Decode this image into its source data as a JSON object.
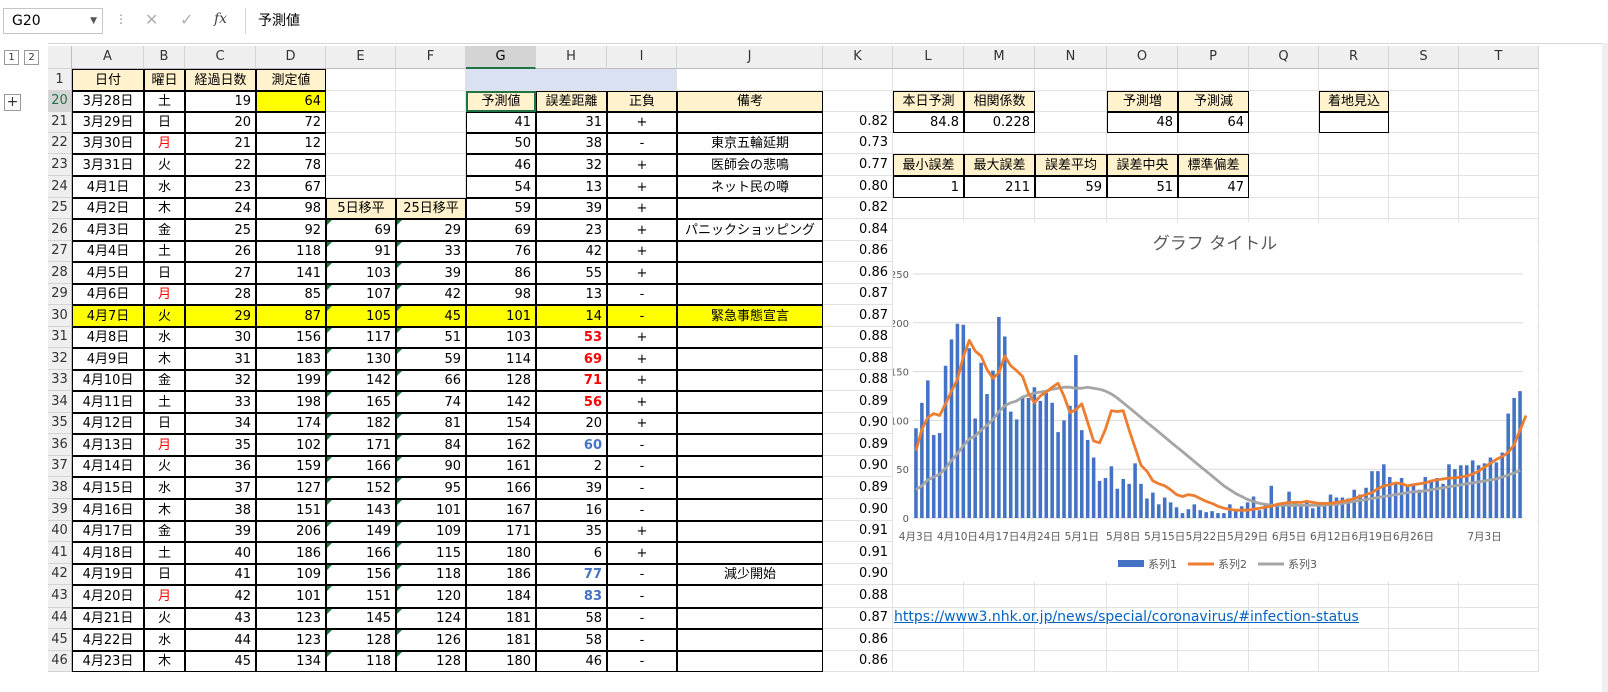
{
  "formula_bar": {
    "name_box": "G20",
    "formula": "予測値",
    "fx": "fx"
  },
  "outline": {
    "levels": [
      "1",
      "2"
    ],
    "expand": "+"
  },
  "columns": [
    "A",
    "B",
    "C",
    "D",
    "E",
    "F",
    "G",
    "H",
    "I",
    "J",
    "K",
    "L",
    "M",
    "N",
    "O",
    "P",
    "Q",
    "R",
    "S",
    "T"
  ],
  "row1": {
    "num": "1",
    "A": "日付",
    "B": "曜日",
    "C": "経過日数",
    "D": "測定値"
  },
  "header_row": {
    "num": "20",
    "A": "3月28日",
    "B": "土",
    "C": "19",
    "D": "64",
    "G": "予測値",
    "H": "誤差距離",
    "I": "正負",
    "J": "備考",
    "L": "本日予測",
    "M": "相関係数",
    "O": "予測増",
    "P": "予測減",
    "R": "着地見込"
  },
  "rows": [
    {
      "num": "21",
      "A": "3月29日",
      "B": "日",
      "C": "20",
      "D": "72",
      "E": "",
      "F": "",
      "G": "41",
      "H": "31",
      "I": "+",
      "J": "",
      "K": "0.82",
      "L": "84.8",
      "M": "0.228",
      "O": "48",
      "P": "64"
    },
    {
      "num": "22",
      "A": "3月30日",
      "B": "月",
      "C": "21",
      "D": "12",
      "E": "",
      "F": "",
      "G": "50",
      "H": "38",
      "I": "-",
      "J": "東京五輪延期",
      "K": "0.73"
    },
    {
      "num": "23",
      "A": "3月31日",
      "B": "火",
      "C": "22",
      "D": "78",
      "E": "",
      "F": "",
      "G": "46",
      "H": "32",
      "I": "+",
      "J": "医師会の悲鳴",
      "K": "0.77",
      "L": "最小誤差",
      "M": "最大誤差",
      "N": "誤差平均",
      "O": "誤差中央",
      "P": "標準偏差"
    },
    {
      "num": "24",
      "A": "4月1日",
      "B": "水",
      "C": "23",
      "D": "67",
      "E": "",
      "F": "",
      "G": "54",
      "H": "13",
      "I": "+",
      "J": "ネット民の噂",
      "K": "0.80",
      "L": "1",
      "M": "211",
      "N": "59",
      "O": "51",
      "P": "47"
    },
    {
      "num": "25",
      "A": "4月2日",
      "B": "木",
      "C": "24",
      "D": "98",
      "E": "5日移平",
      "F": "25日移平",
      "G": "59",
      "H": "39",
      "I": "+",
      "J": "",
      "K": "0.82"
    },
    {
      "num": "26",
      "A": "4月3日",
      "B": "金",
      "C": "25",
      "D": "92",
      "E": "69",
      "F": "29",
      "G": "69",
      "H": "23",
      "I": "+",
      "J": "パニックショッピング",
      "K": "0.84"
    },
    {
      "num": "27",
      "A": "4月4日",
      "B": "土",
      "C": "26",
      "D": "118",
      "E": "91",
      "F": "33",
      "G": "76",
      "H": "42",
      "I": "+",
      "J": "",
      "K": "0.86"
    },
    {
      "num": "28",
      "A": "4月5日",
      "B": "日",
      "C": "27",
      "D": "141",
      "E": "103",
      "F": "39",
      "G": "86",
      "H": "55",
      "I": "+",
      "J": "",
      "K": "0.86"
    },
    {
      "num": "29",
      "A": "4月6日",
      "B": "月",
      "C": "28",
      "D": "85",
      "E": "107",
      "F": "42",
      "G": "98",
      "H": "13",
      "I": "-",
      "J": "",
      "K": "0.87"
    },
    {
      "num": "30",
      "A": "4月7日",
      "B": "火",
      "C": "29",
      "D": "87",
      "E": "105",
      "F": "45",
      "G": "101",
      "H": "14",
      "I": "-",
      "J": "緊急事態宣言",
      "K": "0.87"
    },
    {
      "num": "31",
      "A": "4月8日",
      "B": "水",
      "C": "30",
      "D": "156",
      "E": "117",
      "F": "51",
      "G": "103",
      "H": "53",
      "I": "+",
      "J": "",
      "K": "0.88"
    },
    {
      "num": "32",
      "A": "4月9日",
      "B": "木",
      "C": "31",
      "D": "183",
      "E": "130",
      "F": "59",
      "G": "114",
      "H": "69",
      "I": "+",
      "J": "",
      "K": "0.88"
    },
    {
      "num": "33",
      "A": "4月10日",
      "B": "金",
      "C": "32",
      "D": "199",
      "E": "142",
      "F": "66",
      "G": "128",
      "H": "71",
      "I": "+",
      "J": "",
      "K": "0.88"
    },
    {
      "num": "34",
      "A": "4月11日",
      "B": "土",
      "C": "33",
      "D": "198",
      "E": "165",
      "F": "74",
      "G": "142",
      "H": "56",
      "I": "+",
      "J": "",
      "K": "0.89"
    },
    {
      "num": "35",
      "A": "4月12日",
      "B": "日",
      "C": "34",
      "D": "174",
      "E": "182",
      "F": "81",
      "G": "154",
      "H": "20",
      "I": "+",
      "J": "",
      "K": "0.90"
    },
    {
      "num": "36",
      "A": "4月13日",
      "B": "月",
      "C": "35",
      "D": "102",
      "E": "171",
      "F": "84",
      "G": "162",
      "H": "60",
      "I": "-",
      "J": "",
      "K": "0.89"
    },
    {
      "num": "37",
      "A": "4月14日",
      "B": "火",
      "C": "36",
      "D": "159",
      "E": "166",
      "F": "90",
      "G": "161",
      "H": "2",
      "I": "-",
      "J": "",
      "K": "0.90"
    },
    {
      "num": "38",
      "A": "4月15日",
      "B": "水",
      "C": "37",
      "D": "127",
      "E": "152",
      "F": "95",
      "G": "166",
      "H": "39",
      "I": "-",
      "J": "",
      "K": "0.89"
    },
    {
      "num": "39",
      "A": "4月16日",
      "B": "木",
      "C": "38",
      "D": "151",
      "E": "143",
      "F": "101",
      "G": "167",
      "H": "16",
      "I": "-",
      "J": "",
      "K": "0.90"
    },
    {
      "num": "40",
      "A": "4月17日",
      "B": "金",
      "C": "39",
      "D": "206",
      "E": "149",
      "F": "109",
      "G": "171",
      "H": "35",
      "I": "+",
      "J": "",
      "K": "0.91"
    },
    {
      "num": "41",
      "A": "4月18日",
      "B": "土",
      "C": "40",
      "D": "186",
      "E": "166",
      "F": "115",
      "G": "180",
      "H": "6",
      "I": "+",
      "J": "",
      "K": "0.91"
    },
    {
      "num": "42",
      "A": "4月19日",
      "B": "日",
      "C": "41",
      "D": "109",
      "E": "156",
      "F": "118",
      "G": "186",
      "H": "77",
      "I": "-",
      "J": "減少開始",
      "K": "0.90"
    },
    {
      "num": "43",
      "A": "4月20日",
      "B": "月",
      "C": "42",
      "D": "101",
      "E": "151",
      "F": "120",
      "G": "184",
      "H": "83",
      "I": "-",
      "J": "",
      "K": "0.88"
    },
    {
      "num": "44",
      "A": "4月21日",
      "B": "火",
      "C": "43",
      "D": "123",
      "E": "145",
      "F": "124",
      "G": "181",
      "H": "58",
      "I": "-",
      "J": "",
      "K": "0.87"
    },
    {
      "num": "45",
      "A": "4月22日",
      "B": "水",
      "C": "44",
      "D": "123",
      "E": "128",
      "F": "126",
      "G": "181",
      "H": "58",
      "I": "-",
      "J": "",
      "K": "0.86"
    },
    {
      "num": "46",
      "A": "4月23日",
      "B": "木",
      "C": "45",
      "D": "134",
      "E": "118",
      "F": "128",
      "G": "180",
      "H": "46",
      "I": "-",
      "J": "",
      "K": "0.86"
    }
  ],
  "link": "https://www3.nhk.or.jp/news/special/coronavirus/#infection-status",
  "chart_data": {
    "type": "bar",
    "title": "グラフ タイトル",
    "ylim": [
      0,
      250
    ],
    "yticks": [
      "0",
      "50",
      "100",
      "150",
      "200",
      "250"
    ],
    "xticks": [
      "4月3日",
      "4月10日",
      "4月17日",
      "4月24日",
      "5月1日",
      "5月8日",
      "5月15日",
      "5月22日",
      "5月29日",
      "6月5日",
      "6月12日",
      "6月19日",
      "6月26日",
      "7月3日"
    ],
    "legend_position": "bottom",
    "colors": {
      "series1": "#4472c4",
      "series2": "#ed7d31",
      "series3": "#a5a5a5"
    },
    "series": [
      {
        "name": "系列1",
        "type": "bar",
        "values": [
          92,
          118,
          141,
          85,
          87,
          156,
          183,
          199,
          198,
          174,
          102,
          159,
          127,
          151,
          206,
          186,
          109,
          101,
          123,
          123,
          134,
          120,
          128,
          118,
          88,
          100,
          115,
          167,
          90,
          80,
          62,
          38,
          41,
          53,
          30,
          40,
          35,
          56,
          35,
          20,
          26,
          14,
          21,
          16,
          11,
          5,
          9,
          14,
          8,
          6,
          7,
          5,
          5,
          14,
          8,
          12,
          16,
          22,
          8,
          14,
          33,
          12,
          15,
          27,
          16,
          14,
          18,
          10,
          13,
          12,
          24,
          21,
          21,
          20,
          29,
          24,
          31,
          48,
          48,
          55,
          42,
          35,
          41,
          32,
          35,
          29,
          42,
          39,
          41,
          35,
          55,
          50,
          54,
          54,
          59,
          54,
          56,
          62,
          57,
          67,
          107,
          123,
          130
        ]
      },
      {
        "name": "系列2",
        "type": "line",
        "values": [
          69,
          91,
          103,
          107,
          105,
          117,
          130,
          142,
          165,
          182,
          171,
          166,
          152,
          143,
          149,
          166,
          156,
          151,
          145,
          128,
          118,
          125,
          129,
          134,
          138,
          125,
          108,
          111,
          117,
          98,
          79,
          77,
          91,
          110,
          109,
          110,
          90,
          72,
          54,
          48,
          38,
          35,
          33,
          29,
          24,
          22,
          24,
          23,
          20,
          17,
          15,
          12,
          10,
          9,
          8,
          8,
          8,
          9,
          10,
          11,
          12,
          14,
          15,
          16,
          16,
          16,
          17,
          16,
          15,
          15,
          15,
          16,
          17,
          18,
          20,
          22,
          24,
          26,
          30,
          33,
          34,
          36,
          35,
          33,
          34,
          35,
          36,
          38,
          39,
          40,
          41,
          41,
          42,
          43,
          45,
          48,
          52,
          56,
          60,
          63,
          67,
          75,
          90,
          105
        ]
      },
      {
        "name": "系列3",
        "type": "line",
        "values": [
          29,
          33,
          39,
          42,
          45,
          51,
          59,
          66,
          74,
          81,
          84,
          90,
          95,
          101,
          109,
          115,
          118,
          120,
          124,
          126,
          128,
          129,
          130,
          132,
          133,
          134,
          134,
          133,
          133,
          134,
          133,
          132,
          130,
          127,
          123,
          118,
          113,
          108,
          103,
          98,
          93,
          88,
          83,
          78,
          73,
          68,
          63,
          58,
          53,
          48,
          43,
          38,
          33,
          29,
          25,
          22,
          19,
          17,
          15,
          14,
          13,
          13,
          13,
          13,
          13,
          13,
          13,
          13,
          13,
          13,
          14,
          14,
          15,
          16,
          17,
          18,
          19,
          20,
          21,
          22,
          23,
          24,
          25,
          26,
          27,
          27,
          28,
          29,
          30,
          31,
          32,
          33,
          34,
          35,
          36,
          37,
          38,
          39,
          40,
          42,
          44,
          46,
          49
        ]
      }
    ]
  }
}
